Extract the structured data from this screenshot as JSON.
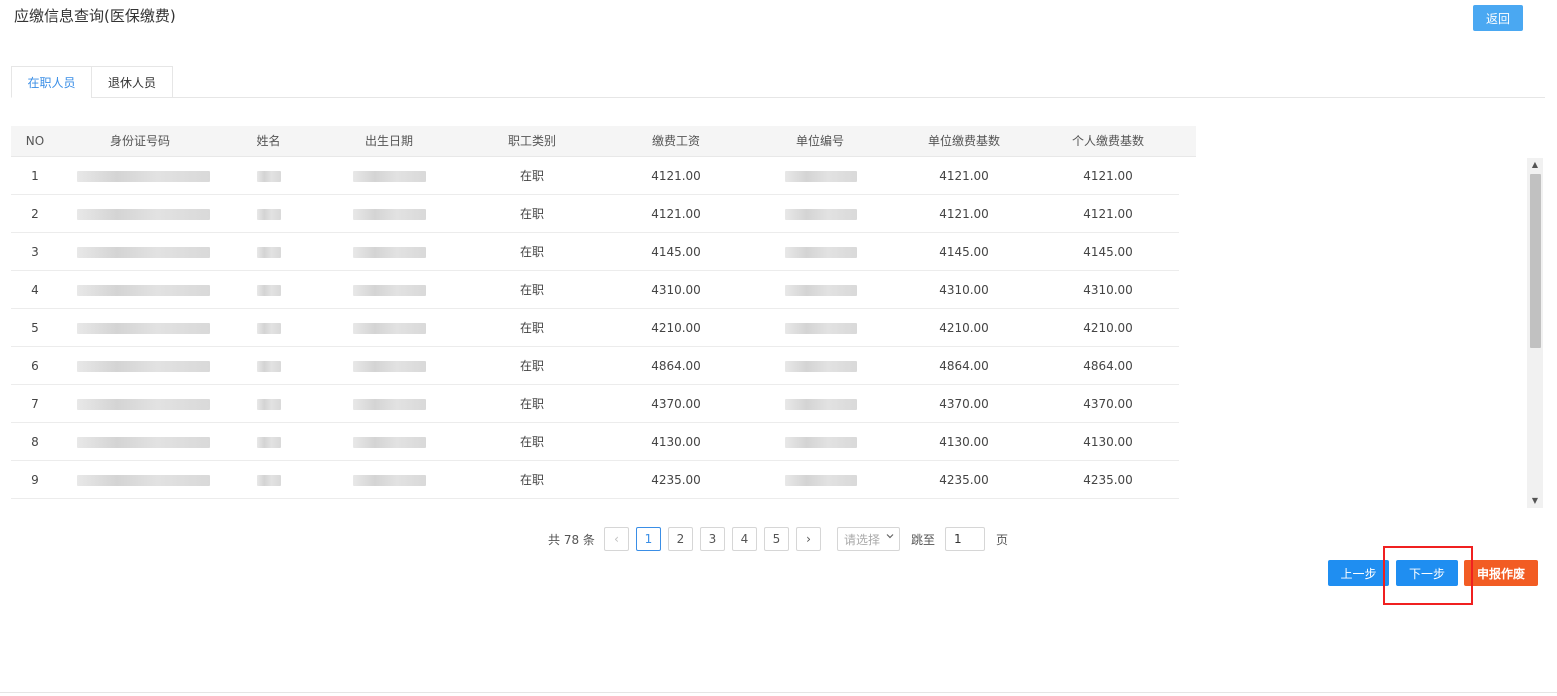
{
  "page": {
    "title": "应缴信息查询(医保缴费)",
    "back_label": "返回"
  },
  "tabs": [
    {
      "label": "在职人员",
      "active": true
    },
    {
      "label": "退休人员",
      "active": false
    }
  ],
  "table": {
    "columns": [
      "NO",
      "身份证号码",
      "姓名",
      "出生日期",
      "职工类别",
      "缴费工资",
      "单位编号",
      "单位缴费基数",
      "个人缴费基数"
    ],
    "rows": [
      {
        "no": "1",
        "category": "在职",
        "wage": "4121.00",
        "unit_base": "4121.00",
        "personal_base": "4121.00"
      },
      {
        "no": "2",
        "category": "在职",
        "wage": "4121.00",
        "unit_base": "4121.00",
        "personal_base": "4121.00"
      },
      {
        "no": "3",
        "category": "在职",
        "wage": "4145.00",
        "unit_base": "4145.00",
        "personal_base": "4145.00"
      },
      {
        "no": "4",
        "category": "在职",
        "wage": "4310.00",
        "unit_base": "4310.00",
        "personal_base": "4310.00"
      },
      {
        "no": "5",
        "category": "在职",
        "wage": "4210.00",
        "unit_base": "4210.00",
        "personal_base": "4210.00"
      },
      {
        "no": "6",
        "category": "在职",
        "wage": "4864.00",
        "unit_base": "4864.00",
        "personal_base": "4864.00"
      },
      {
        "no": "7",
        "category": "在职",
        "wage": "4370.00",
        "unit_base": "4370.00",
        "personal_base": "4370.00"
      },
      {
        "no": "8",
        "category": "在职",
        "wage": "4130.00",
        "unit_base": "4130.00",
        "personal_base": "4130.00"
      },
      {
        "no": "9",
        "category": "在职",
        "wage": "4235.00",
        "unit_base": "4235.00",
        "personal_base": "4235.00"
      }
    ]
  },
  "pagination": {
    "total_text": "共 78 条",
    "prev_icon": "‹",
    "next_icon": "›",
    "pages": [
      "1",
      "2",
      "3",
      "4",
      "5"
    ],
    "current_page": "1",
    "select_placeholder": "请选择",
    "jump_label": "跳至",
    "jump_value": "1",
    "page_suffix": "页"
  },
  "actions": {
    "prev_label": "上一步",
    "next_label": "下一步",
    "void_label": "申报作废"
  },
  "colors": {
    "primary": "#1f8ef1",
    "danger": "#f25c23",
    "highlight_box": "#f02020"
  }
}
